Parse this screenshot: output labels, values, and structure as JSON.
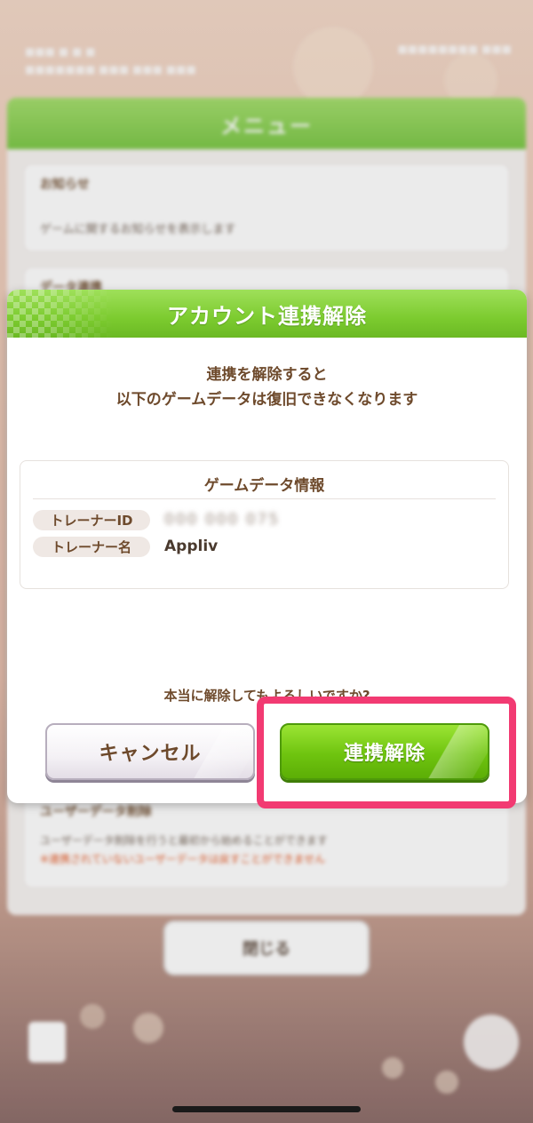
{
  "dialog": {
    "title": "アカウント連携解除",
    "message_line1": "連携を解除すると",
    "message_line2": "以下のゲームデータは復旧できなくなります",
    "info": {
      "title": "ゲームデータ情報",
      "trainer_id_label": "トレーナーID",
      "trainer_id_value": "000 000 075",
      "trainer_name_label": "トレーナー名",
      "trainer_name_value": "Appliv"
    },
    "confirm_text": "本当に解除してもよろしいですか?",
    "cancel_label": "キャンセル",
    "unlink_label": "連携解除"
  },
  "background": {
    "menu_title": "メニュー",
    "news_title": "お知らせ",
    "news_desc": "ゲームに関するお知らせを表示します",
    "data_title": "データ連携",
    "delete_title": "ユーザーデータ削除",
    "delete_desc": "ユーザーデータ削除を行うと最初から始めることができます",
    "delete_warning": "※連携されていないユーザーデータは戻すことができません",
    "close_label": "閉じる"
  },
  "colors": {
    "header_green": "#7ccb2f",
    "primary_button": "#6fc40f",
    "text_brown": "#6e4a2c",
    "highlight": "#f23a72"
  }
}
